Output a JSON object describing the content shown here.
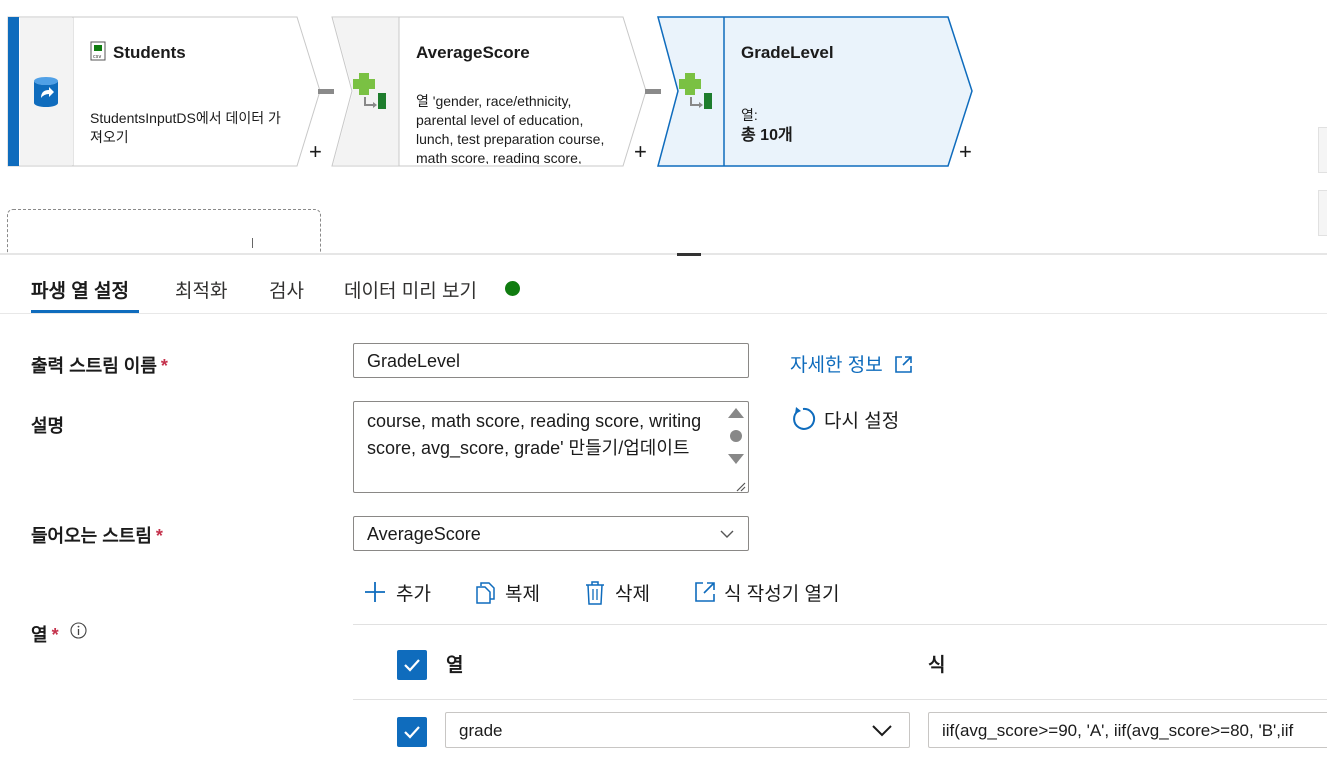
{
  "pipeline": {
    "nodes": [
      {
        "title": "Students",
        "description": "StudentsInputDS에서 데이터 가져오기"
      },
      {
        "title": "AverageScore",
        "description": "열 'gender, race/ethnicity, parental level of education, lunch, test preparation course, math score, reading score,"
      },
      {
        "title": "GradeLevel",
        "columns_label": "열:",
        "columns_count": "총 10개"
      }
    ],
    "add_symbol": "+"
  },
  "tabs": [
    "파생 열 설정",
    "최적화",
    "검사",
    "데이터 미리 보기"
  ],
  "active_tab": "파생 열 설정",
  "form": {
    "output_stream": {
      "label": "출력 스트림 이름",
      "required": "*",
      "value": "GradeLevel"
    },
    "learn_more": "자세한 정보",
    "description": {
      "label": "설명",
      "value": "course, math score, reading score, writing score, avg_score, grade' 만들기/업데이트"
    },
    "reset": "다시 설정",
    "incoming_stream": {
      "label": "들어오는 스트림",
      "required": "*",
      "value": "AverageScore"
    },
    "columns": {
      "label": "열",
      "required": "*"
    }
  },
  "toolbar": {
    "add": "추가",
    "clone": "복제",
    "delete": "삭제",
    "open_builder": "식 작성기 열기"
  },
  "table": {
    "headers": [
      "열",
      "식"
    ],
    "rows": [
      {
        "column": "grade",
        "expression": "iif(avg_score>=90, 'A', iif(avg_score>=80, 'B',iif"
      }
    ]
  },
  "colors": {
    "accent": "#0f6cbd",
    "status": "#107c10",
    "selected_node_fill": "#eaf3fb"
  },
  "icons": [
    "dataset-icon",
    "csv-file-icon",
    "derived-column-icon",
    "info-icon",
    "reset-icon",
    "external-link-icon",
    "plus-icon",
    "copy-icon",
    "trash-icon",
    "chevron-down-icon",
    "checkmark-icon"
  ]
}
